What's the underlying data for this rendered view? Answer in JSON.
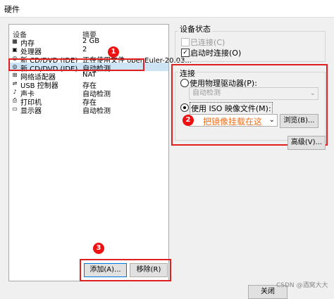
{
  "window": {
    "title": "硬件"
  },
  "hardware_list": {
    "col_device": "设备",
    "col_summary": "摘要",
    "rows": [
      {
        "icon": "memory-icon",
        "device": "内存",
        "summary": "2 GB"
      },
      {
        "icon": "cpu-icon",
        "device": "处理器",
        "summary": "2"
      },
      {
        "icon": "disc-icon",
        "device": "新 CD/DVD (IDE)",
        "summary": "正在使用文件 openEuler-20.03..."
      },
      {
        "icon": "disc-icon",
        "device": "新 CD/DVD (IDE)",
        "summary": "自动检测"
      },
      {
        "icon": "network-icon",
        "device": "网络适配器",
        "summary": "NAT"
      },
      {
        "icon": "usb-icon",
        "device": "USB 控制器",
        "summary": "存在"
      },
      {
        "icon": "sound-icon",
        "device": "声卡",
        "summary": "自动检测"
      },
      {
        "icon": "printer-icon",
        "device": "打印机",
        "summary": "存在"
      },
      {
        "icon": "monitor-icon",
        "device": "显示器",
        "summary": "自动检测"
      }
    ],
    "selected_index": 3
  },
  "annotations": {
    "badge1": "1",
    "badge2": "2",
    "badge3": "3",
    "note": "把镜像挂载在这"
  },
  "buttons": {
    "add": "添加(A)...",
    "remove": "移除(R)",
    "browse": "浏览(B)...",
    "advanced": "高级(V)...",
    "ok": "关闭"
  },
  "device_status": {
    "title": "设备状态",
    "connected": "已连接(C)",
    "connect_at_power_on": "启动时连接(O)"
  },
  "connection": {
    "title": "连接",
    "use_physical": "使用物理驱动器(P):",
    "physical_value": "自动检测",
    "use_iso": "使用 ISO 映像文件(M):",
    "iso_value": ""
  },
  "watermark": "CSDN @酒窝大大"
}
